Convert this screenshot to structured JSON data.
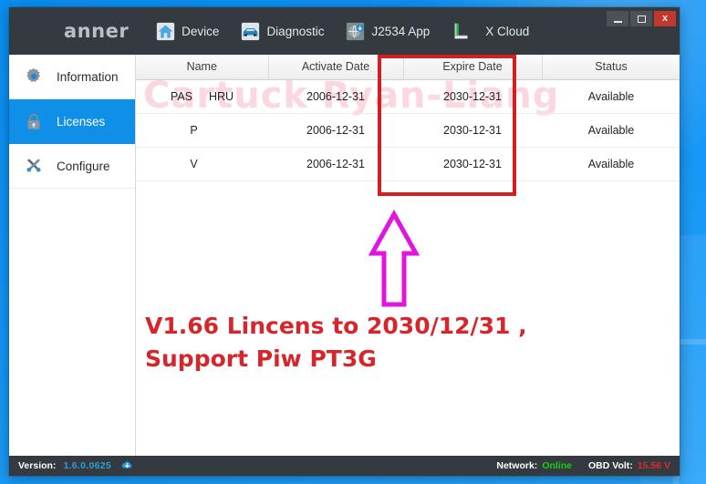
{
  "window": {
    "logo_text": "anner",
    "controls": {
      "minimize": "minimize",
      "maximize": "maximize",
      "close": "x"
    }
  },
  "toolbar": {
    "items": [
      {
        "label": "Device",
        "icon": "home-icon"
      },
      {
        "label": "Diagnostic",
        "icon": "car-icon"
      },
      {
        "label": "J2534 App",
        "icon": "globe-download-icon"
      },
      {
        "label": "X Cloud",
        "icon": "cloud-chart-icon"
      }
    ]
  },
  "sidebar": {
    "items": [
      {
        "label": "Information",
        "icon": "gear-icon",
        "active": false
      },
      {
        "label": "Licenses",
        "icon": "lock-icon",
        "active": true
      },
      {
        "label": "Configure",
        "icon": "tools-icon",
        "active": false
      }
    ]
  },
  "main": {
    "watermark": "Cartuck Ryan-Liang",
    "table": {
      "columns": [
        "Name",
        "Activate Date",
        "Expire Date",
        "Status"
      ],
      "rows": [
        {
          "name": "PAS",
          "name2": "HRU",
          "activate_date": "2006-12-31",
          "expire_date": "2030-12-31",
          "status": "Available"
        },
        {
          "name": "P",
          "name2": "",
          "activate_date": "2006-12-31",
          "expire_date": "2030-12-31",
          "status": "Available"
        },
        {
          "name": "V",
          "name2": "",
          "activate_date": "2006-12-31",
          "expire_date": "2030-12-31",
          "status": "Available"
        }
      ]
    }
  },
  "annotation": {
    "line1": "V1.66 Lincens to 2030/12/31 ,",
    "line2": "Support Piw PT3G",
    "text_color": "#d6262b",
    "highlight_color": "#d31f1f",
    "arrow_color": "#e016e0"
  },
  "statusbar": {
    "version_label": "Version:",
    "version_value": "1.6.0.0625",
    "network_label": "Network:",
    "network_value": "Online",
    "volt_label": "OBD Volt:",
    "volt_value": "15.56 V"
  }
}
